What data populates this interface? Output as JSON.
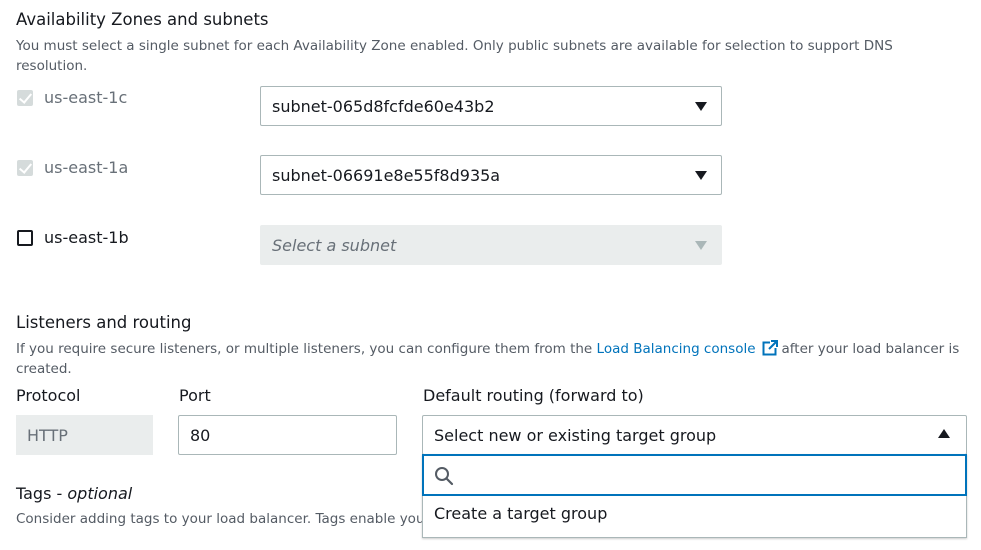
{
  "az_section": {
    "title": "Availability Zones and subnets",
    "description_line1": "You must select a single subnet for each Availability Zone enabled. Only public subnets are available for selection to support DNS",
    "description_line2": "resolution.",
    "zones": [
      {
        "label": "us-east-1c",
        "checked": true,
        "disabled": true,
        "subnet": "subnet-065d8fcfde60e43b2"
      },
      {
        "label": "us-east-1a",
        "checked": true,
        "disabled": true,
        "subnet": "subnet-06691e8e55f8d935a"
      },
      {
        "label": "us-east-1b",
        "checked": false,
        "disabled": false,
        "subnet_placeholder": "Select a subnet"
      }
    ]
  },
  "listeners": {
    "title": "Listeners and routing",
    "description_before_link": "If you require secure listeners, or multiple listeners, you can configure them from the",
    "link_text": "Load Balancing console",
    "description_after_link": "after your load balancer is",
    "description_line2": "created.",
    "protocol_label": "Protocol",
    "protocol_value": "HTTP",
    "port_label": "Port",
    "port_value": "80",
    "routing_label": "Default routing (forward to)",
    "routing_value": "Select new or existing target group",
    "dropdown": {
      "search_placeholder": "",
      "options": [
        "Create a target group"
      ]
    }
  },
  "tags": {
    "title_prefix": "Tags - ",
    "title_suffix": "optional",
    "description": "Consider adding tags to your load balancer. Tags enable you"
  },
  "colors": {
    "link": "#0073bb",
    "focus_border": "#0073bb",
    "disabled_bg": "#eaeded"
  }
}
